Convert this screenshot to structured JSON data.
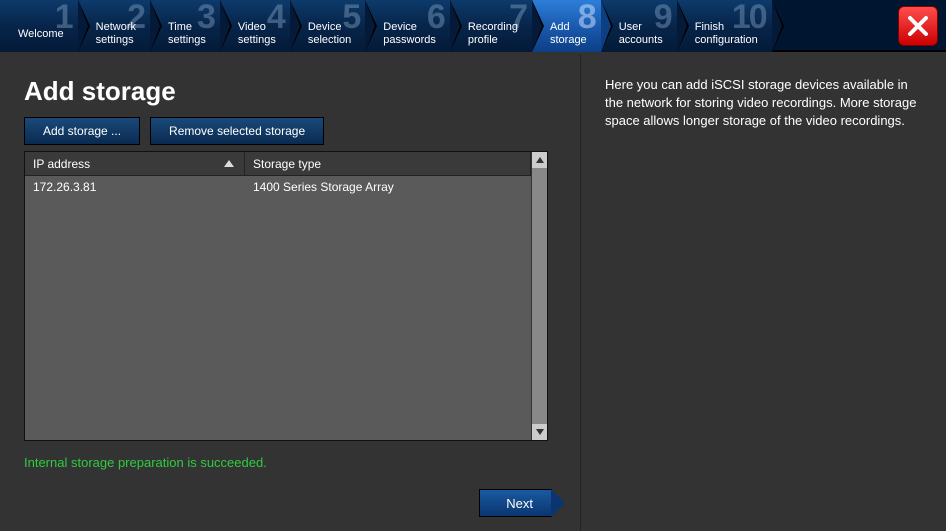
{
  "steps": [
    {
      "num": "1",
      "label": "Welcome"
    },
    {
      "num": "2",
      "label": "Network\nsettings"
    },
    {
      "num": "3",
      "label": "Time\nsettings"
    },
    {
      "num": "4",
      "label": "Video\nsettings"
    },
    {
      "num": "5",
      "label": "Device\nselection"
    },
    {
      "num": "6",
      "label": "Device\npasswords"
    },
    {
      "num": "7",
      "label": "Recording\nprofile"
    },
    {
      "num": "8",
      "label": "Add\nstorage"
    },
    {
      "num": "9",
      "label": "User\naccounts"
    },
    {
      "num": "10",
      "label": "Finish\nconfiguration"
    }
  ],
  "active_step_index": 7,
  "page": {
    "title": "Add storage",
    "add_btn": "Add storage ...",
    "remove_btn": "Remove selected storage",
    "next_btn": "Next",
    "status": "Internal storage preparation is succeeded."
  },
  "table": {
    "headers": {
      "ip": "IP address",
      "type": "Storage type"
    },
    "rows": [
      {
        "ip": "172.26.3.81",
        "type": "1400 Series Storage Array"
      }
    ]
  },
  "help": "Here you can add iSCSI storage devices available in the network for storing video recordings. More storage space allows longer storage of the video recordings."
}
